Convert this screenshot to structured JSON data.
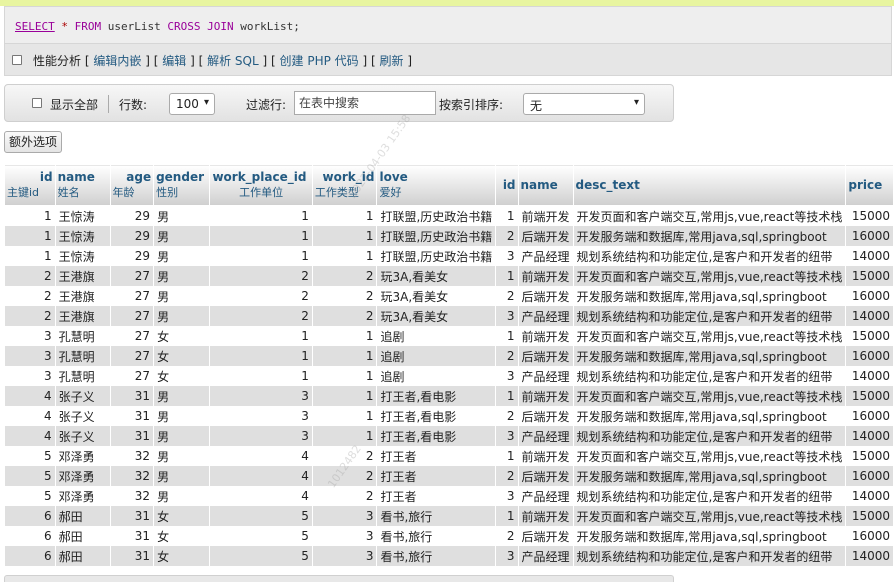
{
  "sql": {
    "select": "SELECT",
    "star": "*",
    "from": "FROM",
    "table1": "userList",
    "cross": "CROSS",
    "join": "JOIN",
    "table2": "workList;"
  },
  "profiling": {
    "label": "性能分析",
    "open": "[",
    "close": "]",
    "links": [
      "编辑内嵌",
      "编辑",
      "解析 SQL",
      "创建 PHP 代码",
      "刷新"
    ]
  },
  "options": {
    "show_all": "显示全部",
    "rows_label": "行数:",
    "rows_value": "100",
    "filter_label": "过滤行:",
    "filter_placeholder": "在表中搜索",
    "sort_label": "按索引排序:",
    "sort_value": "无"
  },
  "extra_options": "额外选项",
  "columns": [
    {
      "name": "id",
      "comment": "主键id"
    },
    {
      "name": "name",
      "comment": "姓名"
    },
    {
      "name": "age",
      "comment": "年龄"
    },
    {
      "name": "gender",
      "comment": "性别"
    },
    {
      "name": "work_place_id",
      "comment": "工作单位"
    },
    {
      "name": "work_id",
      "comment": "工作类型"
    },
    {
      "name": "love",
      "comment": "爱好"
    },
    {
      "name": "id",
      "comment": ""
    },
    {
      "name": "name",
      "comment": ""
    },
    {
      "name": "desc_text",
      "comment": ""
    },
    {
      "name": "price",
      "comment": ""
    }
  ],
  "rows": [
    [
      "1",
      "王惊涛",
      "29",
      "男",
      "1",
      "1",
      "打联盟,历史政治书籍",
      "1",
      "前端开发",
      "开发页面和客户端交互,常用js,vue,react等技术栈",
      "15000"
    ],
    [
      "1",
      "王惊涛",
      "29",
      "男",
      "1",
      "1",
      "打联盟,历史政治书籍",
      "2",
      "后端开发",
      "开发服务端和数据库,常用java,sql,springboot",
      "16000"
    ],
    [
      "1",
      "王惊涛",
      "29",
      "男",
      "1",
      "1",
      "打联盟,历史政治书籍",
      "3",
      "产品经理",
      "规划系统结构和功能定位,是客户和开发者的纽带",
      "14000"
    ],
    [
      "2",
      "王港旗",
      "27",
      "男",
      "2",
      "2",
      "玩3A,看美女",
      "1",
      "前端开发",
      "开发页面和客户端交互,常用js,vue,react等技术栈",
      "15000"
    ],
    [
      "2",
      "王港旗",
      "27",
      "男",
      "2",
      "2",
      "玩3A,看美女",
      "2",
      "后端开发",
      "开发服务端和数据库,常用java,sql,springboot",
      "16000"
    ],
    [
      "2",
      "王港旗",
      "27",
      "男",
      "2",
      "2",
      "玩3A,看美女",
      "3",
      "产品经理",
      "规划系统结构和功能定位,是客户和开发者的纽带",
      "14000"
    ],
    [
      "3",
      "孔慧明",
      "27",
      "女",
      "1",
      "1",
      "追剧",
      "1",
      "前端开发",
      "开发页面和客户端交互,常用js,vue,react等技术栈",
      "15000"
    ],
    [
      "3",
      "孔慧明",
      "27",
      "女",
      "1",
      "1",
      "追剧",
      "2",
      "后端开发",
      "开发服务端和数据库,常用java,sql,springboot",
      "16000"
    ],
    [
      "3",
      "孔慧明",
      "27",
      "女",
      "1",
      "1",
      "追剧",
      "3",
      "产品经理",
      "规划系统结构和功能定位,是客户和开发者的纽带",
      "14000"
    ],
    [
      "4",
      "张子义",
      "31",
      "男",
      "3",
      "1",
      "打王者,看电影",
      "1",
      "前端开发",
      "开发页面和客户端交互,常用js,vue,react等技术栈",
      "15000"
    ],
    [
      "4",
      "张子义",
      "31",
      "男",
      "3",
      "1",
      "打王者,看电影",
      "2",
      "后端开发",
      "开发服务端和数据库,常用java,sql,springboot",
      "16000"
    ],
    [
      "4",
      "张子义",
      "31",
      "男",
      "3",
      "1",
      "打王者,看电影",
      "3",
      "产品经理",
      "规划系统结构和功能定位,是客户和开发者的纽带",
      "14000"
    ],
    [
      "5",
      "邓泽勇",
      "32",
      "男",
      "4",
      "2",
      "打王者",
      "1",
      "前端开发",
      "开发页面和客户端交互,常用js,vue,react等技术栈",
      "15000"
    ],
    [
      "5",
      "邓泽勇",
      "32",
      "男",
      "4",
      "2",
      "打王者",
      "2",
      "后端开发",
      "开发服务端和数据库,常用java,sql,springboot",
      "16000"
    ],
    [
      "5",
      "邓泽勇",
      "32",
      "男",
      "4",
      "2",
      "打王者",
      "3",
      "产品经理",
      "规划系统结构和功能定位,是客户和开发者的纽带",
      "14000"
    ],
    [
      "6",
      "郝田",
      "31",
      "女",
      "5",
      "3",
      "看书,旅行",
      "1",
      "前端开发",
      "开发页面和客户端交互,常用js,vue,react等技术栈",
      "15000"
    ],
    [
      "6",
      "郝田",
      "31",
      "女",
      "5",
      "3",
      "看书,旅行",
      "2",
      "后端开发",
      "开发服务端和数据库,常用java,sql,springboot",
      "16000"
    ],
    [
      "6",
      "郝田",
      "31",
      "女",
      "5",
      "3",
      "看书,旅行",
      "3",
      "产品经理",
      "规划系统结构和功能定位,是客户和开发者的纽带",
      "14000"
    ]
  ],
  "colors": {
    "link": "#235a81",
    "keyword": "#990099",
    "row_alt": "#dfdfdf",
    "top_accent": "#e8f5a0"
  }
}
